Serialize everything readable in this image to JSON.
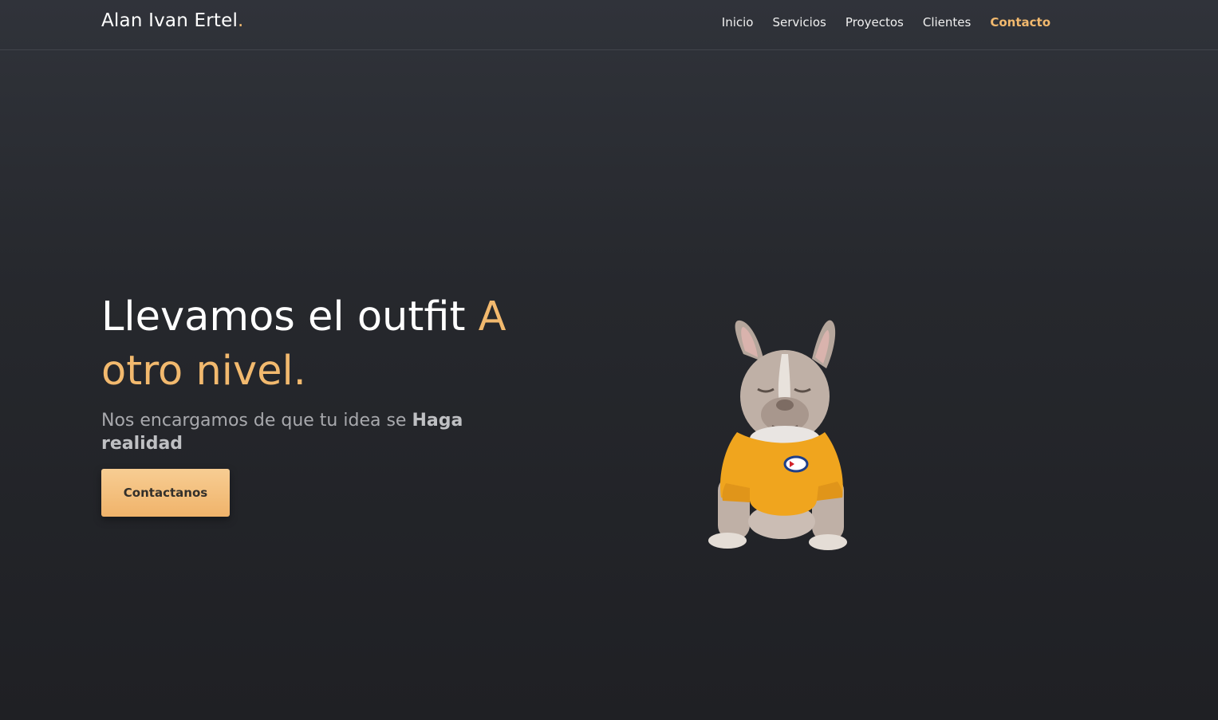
{
  "brand": {
    "name": "Alan Ivan Ertel",
    "dot": "."
  },
  "nav": {
    "items": [
      {
        "label": "Inicio"
      },
      {
        "label": "Servicios"
      },
      {
        "label": "Proyectos"
      },
      {
        "label": "Clientes"
      },
      {
        "label": "Contacto"
      }
    ],
    "active": "Contacto"
  },
  "hero": {
    "title_main": "Llevamos el outfit ",
    "title_accent": "A otro nivel.",
    "subtitle_text": "Nos encargamos de que tu idea se ",
    "subtitle_bold": "Haga realidad",
    "cta_label": "Contactanos",
    "image_name": "french-bulldog-yellow-sweater"
  },
  "colors": {
    "accent": "#f2b96e",
    "background": "#26282d",
    "text": "#ffffff",
    "muted": "#a8a9ad"
  }
}
